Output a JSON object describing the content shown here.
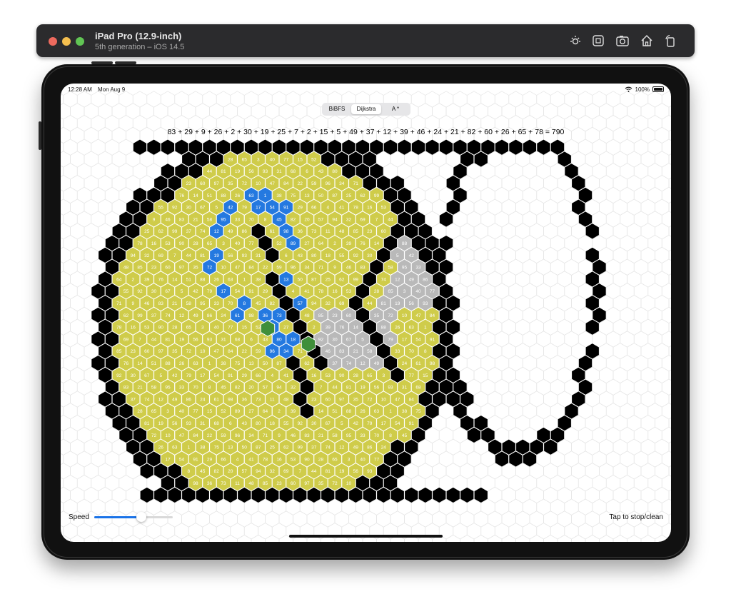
{
  "simulator": {
    "title": "iPad Pro (12.9-inch)",
    "subtitle": "5th generation – iOS 14.5",
    "tools": [
      "brightness-icon",
      "home-button-icon",
      "screenshot-icon",
      "home-icon",
      "rotate-icon"
    ]
  },
  "status_bar": {
    "time": "12:28 AM",
    "date": "Mon Aug 9",
    "battery": "100%"
  },
  "segmented": {
    "options": [
      "BiBFS",
      "Dijkstra",
      "A *"
    ],
    "selected": "Dijkstra"
  },
  "equation": "83 + 29 + 9 + 26 + 2 + 30 + 19 + 25 + 7 + 2 + 15 + 5 + 49 + 37 + 12 + 39 + 46 + 24 + 21 + 82 + 60 + 26 + 65 + 78 = 790",
  "speed": {
    "label": "Speed",
    "value": 0.6
  },
  "tap_hint": "Tap to stop/clean",
  "colors": {
    "wall": "#000000",
    "visited": "#cfcc4a",
    "frontier": "#b9b9b9",
    "path": "#2479e0",
    "start": "#3f8f3a",
    "end": "#3f8f3a",
    "empty_stroke": "#e6e6e6"
  }
}
